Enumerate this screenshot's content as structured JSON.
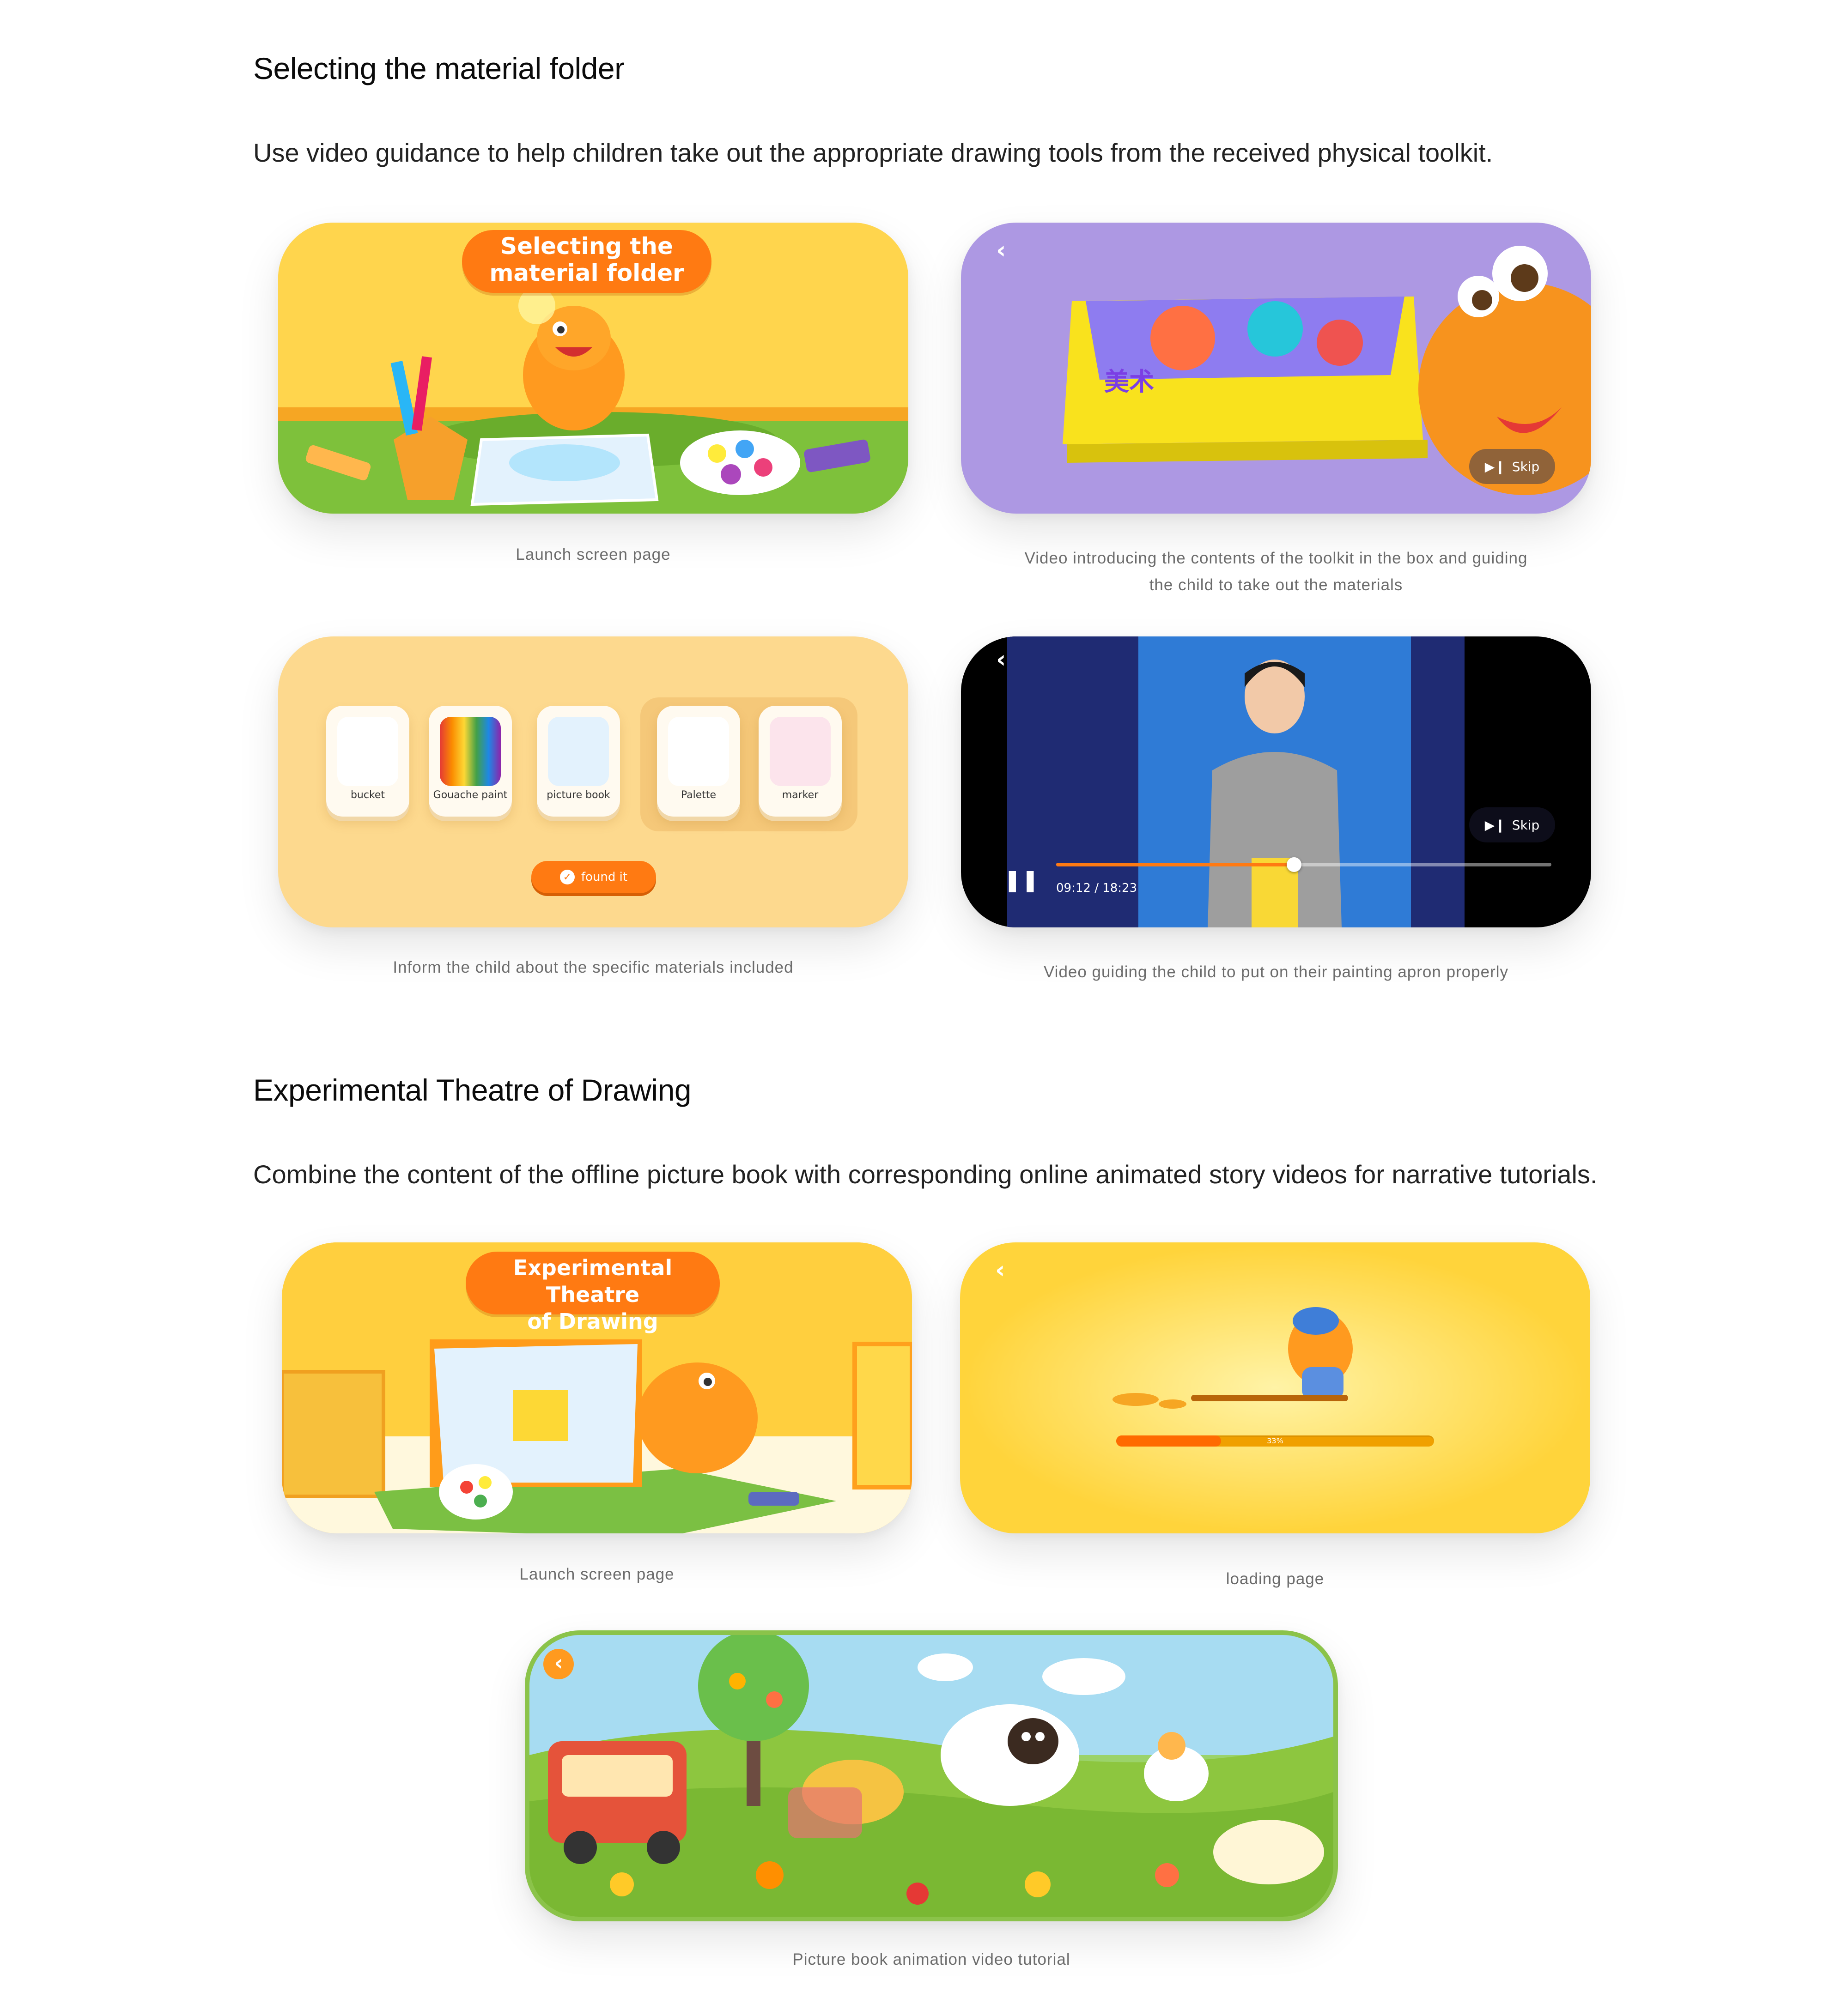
{
  "section1": {
    "title": "Selecting the material folder",
    "description": "Use video guidance to help children take out the appropriate drawing tools from the received physical toolkit.",
    "launch": {
      "bubble_line1": "Selecting the",
      "bubble_line2": "material folder",
      "caption": "Launch screen page"
    },
    "video_intro": {
      "box_title": "美术",
      "skip": "Skip",
      "caption_line1": "Video introducing the contents of the toolkit in the box and guiding",
      "caption_line2": "the child to take out the materials"
    },
    "materials": {
      "items": [
        "bucket",
        "Gouache paint",
        "picture book",
        "Palette",
        "marker"
      ],
      "button": "found it",
      "caption": "Inform the child about the specific materials included"
    },
    "apron_video": {
      "skip": "Skip",
      "time": "09:12 / 18:23",
      "progress": 0.48,
      "caption": "Video guiding the child to put on their painting apron properly"
    }
  },
  "section2": {
    "title": "Experimental Theatre of Drawing",
    "description": "Combine the content of the offline picture book with corresponding online animated story videos for narrative tutorials.",
    "launch": {
      "bubble_line1": "Experimental Theatre",
      "bubble_line2": "of Drawing",
      "caption": "Launch screen page"
    },
    "loading": {
      "percent_label": "33%",
      "progress": 0.33,
      "caption": "loading page"
    },
    "picture_book": {
      "caption": "Picture book animation video tutorial"
    }
  },
  "colors": {
    "orange": "#ff7a12",
    "yellow": "#ffd44a",
    "purple": "#b29be6",
    "navy": "#1f2b73",
    "green": "#8bc34a"
  }
}
